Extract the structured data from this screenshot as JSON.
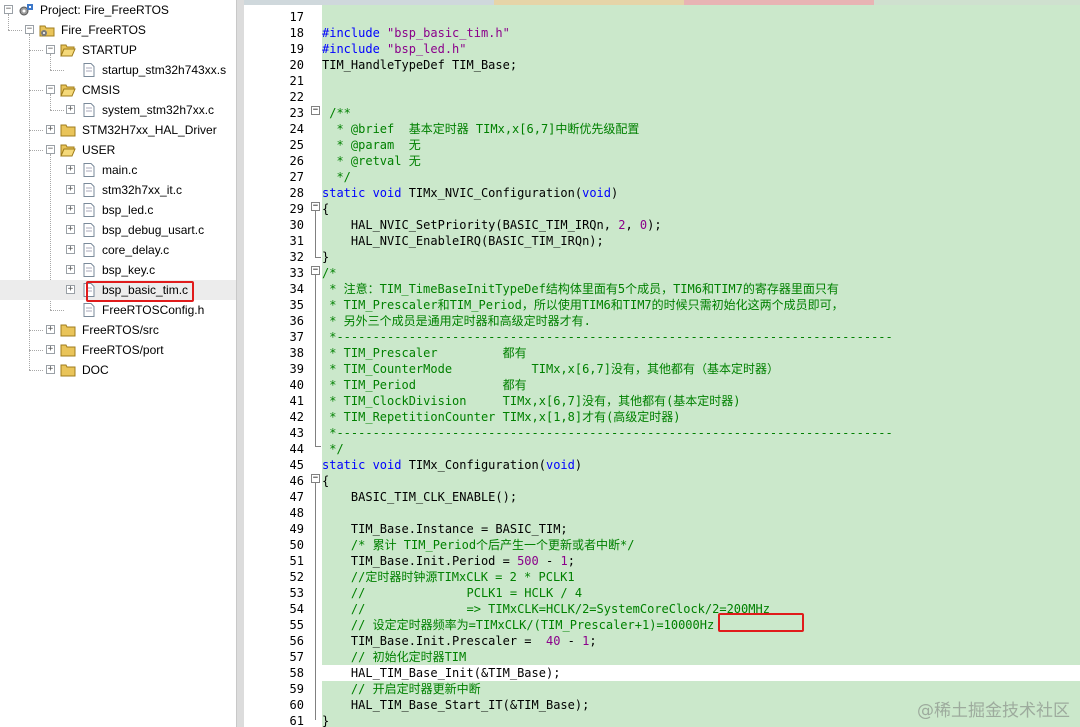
{
  "project": {
    "root_label": "Project: Fire_FreeRTOS",
    "target_label": "Fire_FreeRTOS",
    "groups": {
      "startup": {
        "label": "STARTUP",
        "files": [
          "startup_stm32h743xx.s"
        ]
      },
      "cmsis": {
        "label": "CMSIS",
        "files": [
          "system_stm32h7xx.c"
        ]
      },
      "hal": {
        "label": "STM32H7xx_HAL_Driver"
      },
      "user": {
        "label": "USER",
        "files": [
          "main.c",
          "stm32h7xx_it.c",
          "bsp_led.c",
          "bsp_debug_usart.c",
          "core_delay.c",
          "bsp_key.c",
          "bsp_basic_tim.c",
          "FreeRTOSConfig.h"
        ]
      },
      "freertos_src": {
        "label": "FreeRTOS/src"
      },
      "freertos_port": {
        "label": "FreeRTOS/port"
      },
      "doc": {
        "label": "DOC"
      }
    },
    "selected_file": "bsp_basic_tim.c"
  },
  "editor": {
    "lines": [
      {
        "n": "17",
        "segs": [
          {
            "t": "",
            "c": ""
          }
        ]
      },
      {
        "n": "18",
        "segs": [
          {
            "t": "#include ",
            "c": "pp"
          },
          {
            "t": "\"bsp_basic_tim.h\"",
            "c": "str"
          }
        ]
      },
      {
        "n": "19",
        "segs": [
          {
            "t": "#include ",
            "c": "pp"
          },
          {
            "t": "\"bsp_led.h\"",
            "c": "str"
          }
        ]
      },
      {
        "n": "20",
        "segs": [
          {
            "t": "TIM_HandleTypeDef TIM_Base;",
            "c": ""
          }
        ]
      },
      {
        "n": "21",
        "segs": [
          {
            "t": "",
            "c": ""
          }
        ]
      },
      {
        "n": "22",
        "segs": [
          {
            "t": "",
            "c": ""
          }
        ]
      },
      {
        "n": "23",
        "segs": [
          {
            "t": " /**",
            "c": "cm"
          }
        ]
      },
      {
        "n": "24",
        "segs": [
          {
            "t": "  * @brief  基本定时器 TIMx,x[6,7]中断优先级配置",
            "c": "cm"
          }
        ]
      },
      {
        "n": "25",
        "segs": [
          {
            "t": "  * @param  无",
            "c": "cm"
          }
        ]
      },
      {
        "n": "26",
        "segs": [
          {
            "t": "  * @retval 无",
            "c": "cm"
          }
        ]
      },
      {
        "n": "27",
        "segs": [
          {
            "t": "  */",
            "c": "cm"
          }
        ]
      },
      {
        "n": "28",
        "segs": [
          {
            "t": "static ",
            "c": "kw"
          },
          {
            "t": "void ",
            "c": "kw"
          },
          {
            "t": "TIMx_NVIC_Configuration(",
            "c": ""
          },
          {
            "t": "void",
            "c": "kw"
          },
          {
            "t": ")",
            "c": ""
          }
        ]
      },
      {
        "n": "29",
        "segs": [
          {
            "t": "{",
            "c": ""
          }
        ]
      },
      {
        "n": "30",
        "segs": [
          {
            "t": "    HAL_NVIC_SetPriority(BASIC_TIM_IRQn, ",
            "c": ""
          },
          {
            "t": "2",
            "c": "num"
          },
          {
            "t": ", ",
            "c": ""
          },
          {
            "t": "0",
            "c": "num"
          },
          {
            "t": ");",
            "c": ""
          }
        ]
      },
      {
        "n": "31",
        "segs": [
          {
            "t": "    HAL_NVIC_EnableIRQ(BASIC_TIM_IRQn);",
            "c": ""
          }
        ]
      },
      {
        "n": "32",
        "segs": [
          {
            "t": "}",
            "c": ""
          }
        ]
      },
      {
        "n": "33",
        "segs": [
          {
            "t": "/*",
            "c": "cm"
          }
        ]
      },
      {
        "n": "34",
        "segs": [
          {
            "t": " * 注意：TIM_TimeBaseInitTypeDef结构体里面有5个成员，TIM6和TIM7的寄存器里面只有",
            "c": "cm"
          }
        ]
      },
      {
        "n": "35",
        "segs": [
          {
            "t": " * TIM_Prescaler和TIM_Period，所以使用TIM6和TIM7的时候只需初始化这两个成员即可，",
            "c": "cm"
          }
        ]
      },
      {
        "n": "36",
        "segs": [
          {
            "t": " * 另外三个成员是通用定时器和高级定时器才有.",
            "c": "cm"
          }
        ]
      },
      {
        "n": "37",
        "segs": [
          {
            "t": " *-----------------------------------------------------------------------------",
            "c": "cm"
          }
        ]
      },
      {
        "n": "38",
        "segs": [
          {
            "t": " * TIM_Prescaler         都有",
            "c": "cm"
          }
        ]
      },
      {
        "n": "39",
        "segs": [
          {
            "t": " * TIM_CounterMode           TIMx,x[6,7]没有，其他都有（基本定时器）",
            "c": "cm"
          }
        ]
      },
      {
        "n": "40",
        "segs": [
          {
            "t": " * TIM_Period            都有",
            "c": "cm"
          }
        ]
      },
      {
        "n": "41",
        "segs": [
          {
            "t": " * TIM_ClockDivision     TIMx,x[6,7]没有，其他都有(基本定时器)",
            "c": "cm"
          }
        ]
      },
      {
        "n": "42",
        "segs": [
          {
            "t": " * TIM_RepetitionCounter TIMx,x[1,8]才有(高级定时器)",
            "c": "cm"
          }
        ]
      },
      {
        "n": "43",
        "segs": [
          {
            "t": " *-----------------------------------------------------------------------------",
            "c": "cm"
          }
        ]
      },
      {
        "n": "44",
        "segs": [
          {
            "t": " */",
            "c": "cm"
          }
        ]
      },
      {
        "n": "45",
        "segs": [
          {
            "t": "static ",
            "c": "kw"
          },
          {
            "t": "void ",
            "c": "kw"
          },
          {
            "t": "TIMx_Configuration(",
            "c": ""
          },
          {
            "t": "void",
            "c": "kw"
          },
          {
            "t": ")",
            "c": ""
          }
        ]
      },
      {
        "n": "46",
        "segs": [
          {
            "t": "{",
            "c": ""
          }
        ]
      },
      {
        "n": "47",
        "segs": [
          {
            "t": "    BASIC_TIM_CLK_ENABLE();",
            "c": ""
          }
        ]
      },
      {
        "n": "48",
        "segs": [
          {
            "t": "",
            "c": ""
          }
        ]
      },
      {
        "n": "49",
        "segs": [
          {
            "t": "    TIM_Base.Instance = BASIC_TIM;",
            "c": ""
          }
        ]
      },
      {
        "n": "50",
        "segs": [
          {
            "t": "    /* 累计 TIM_Period个后产生一个更新或者中断*/",
            "c": "cm"
          }
        ]
      },
      {
        "n": "51",
        "segs": [
          {
            "t": "    TIM_Base.Init.Period = ",
            "c": ""
          },
          {
            "t": "500",
            "c": "num"
          },
          {
            "t": " - ",
            "c": ""
          },
          {
            "t": "1",
            "c": "num"
          },
          {
            "t": ";",
            "c": ""
          }
        ]
      },
      {
        "n": "52",
        "segs": [
          {
            "t": "    //定时器时钟源TIMxCLK = 2 * PCLK1",
            "c": "cm"
          }
        ]
      },
      {
        "n": "53",
        "segs": [
          {
            "t": "    //              PCLK1 = HCLK / 4",
            "c": "cm"
          }
        ]
      },
      {
        "n": "54",
        "segs": [
          {
            "t": "    //              => TIMxCLK=HCLK/2=SystemCoreClock/2=200MHz",
            "c": "cm"
          }
        ]
      },
      {
        "n": "55",
        "segs": [
          {
            "t": "    // 设定定时器频率为=TIMxCLK/(TIM_Prescaler+1)=10000Hz",
            "c": "cm"
          }
        ]
      },
      {
        "n": "56",
        "segs": [
          {
            "t": "    TIM_Base.Init.Prescaler =  ",
            "c": ""
          },
          {
            "t": "40",
            "c": "num"
          },
          {
            "t": " - ",
            "c": ""
          },
          {
            "t": "1",
            "c": "num"
          },
          {
            "t": ";",
            "c": ""
          }
        ]
      },
      {
        "n": "57",
        "segs": [
          {
            "t": "    // 初始化定时器TIM",
            "c": "cm"
          }
        ]
      },
      {
        "n": "58",
        "segs": [
          {
            "t": "    HAL_TIM_Base_Init(&TIM_Base);",
            "c": ""
          }
        ]
      },
      {
        "n": "59",
        "segs": [
          {
            "t": "    // 开启定时器更新中断",
            "c": "cm"
          }
        ]
      },
      {
        "n": "60",
        "segs": [
          {
            "t": "    HAL_TIM_Base_Start_IT(&TIM_Base);",
            "c": ""
          }
        ]
      },
      {
        "n": "61",
        "segs": [
          {
            "t": "}",
            "c": ""
          }
        ]
      }
    ]
  },
  "watermark": "@稀土掘金技术社区"
}
